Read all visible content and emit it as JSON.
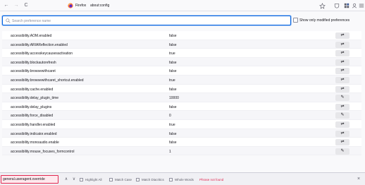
{
  "toolbar": {
    "back_glyph": "←",
    "forward_glyph": "→",
    "reload_glyph": "C",
    "brand": "Firefox",
    "url": "about:config"
  },
  "search": {
    "placeholder": "Search preference name",
    "value": "",
    "show_modified_label": "Show only modified preferences"
  },
  "prefs": [
    {
      "name": "accessibility.AOM.enabled",
      "value": "false",
      "button": "⇌"
    },
    {
      "name": "accessibility.ARIAReflection.enabled",
      "value": "false",
      "button": "⇌"
    },
    {
      "name": "accessibility.accesskeycausesactivation",
      "value": "true",
      "button": "⇌"
    },
    {
      "name": "accessibility.blockautorefresh",
      "value": "false",
      "button": "⇌"
    },
    {
      "name": "accessibility.browsewithcaret",
      "value": "false",
      "button": "⇌"
    },
    {
      "name": "accessibility.browsewithcaret_shortcut.enabled",
      "value": "true",
      "button": "⇌"
    },
    {
      "name": "accessibility.cache.enabled",
      "value": "false",
      "button": "⇌"
    },
    {
      "name": "accessibility.delay_plugin_time",
      "value": "10000",
      "button": "✎"
    },
    {
      "name": "accessibility.delay_plugins",
      "value": "false",
      "button": "⇌"
    },
    {
      "name": "accessibility.force_disabled",
      "value": "0",
      "button": "✎"
    },
    {
      "name": "accessibility.handler.enabled",
      "value": "true",
      "button": "⇌"
    },
    {
      "name": "accessibility.indicator.enabled",
      "value": "false",
      "button": "⇌"
    },
    {
      "name": "accessibility.monoaudio.enable",
      "value": "false",
      "button": "⇌"
    },
    {
      "name": "accessibility.mouse_focuses_formcontrol",
      "value": "1",
      "button": "✎"
    }
  ],
  "findbar": {
    "value": "general.useragent.override",
    "prev_glyph": "∧",
    "next_glyph": "∨",
    "highlight_all": "Highlight All",
    "match_case": "Match Case",
    "match_diacritics": "Match Diacritics",
    "whole_words": "Whole Words",
    "status": "Phrase not found",
    "close_glyph": "×"
  },
  "colors": {
    "accent": "#0061e0",
    "error": "#e22850"
  }
}
